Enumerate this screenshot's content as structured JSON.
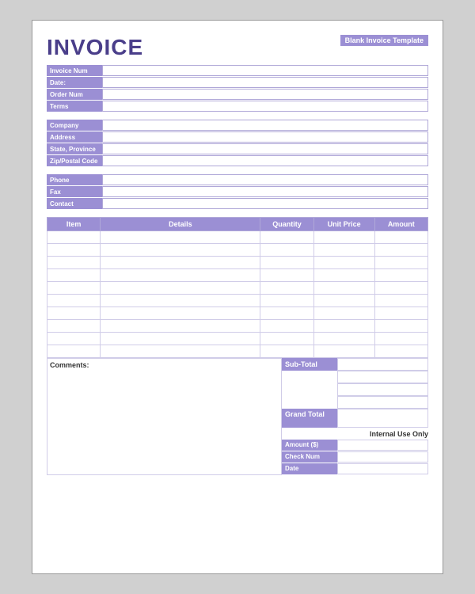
{
  "header": {
    "title": "INVOICE",
    "template_label": "Blank Invoice Template"
  },
  "invoice_info": [
    {
      "label": "Invoice Num",
      "value": ""
    },
    {
      "label": "Date:",
      "value": ""
    },
    {
      "label": "Order Num",
      "value": ""
    },
    {
      "label": "Terms",
      "value": ""
    }
  ],
  "company_info": [
    {
      "label": "Company",
      "value": ""
    },
    {
      "label": "Address",
      "value": ""
    },
    {
      "label": "State, Province",
      "value": ""
    },
    {
      "label": "Zip/Postal Code",
      "value": ""
    }
  ],
  "contact_info": [
    {
      "label": "Phone",
      "value": ""
    },
    {
      "label": "Fax",
      "value": ""
    },
    {
      "label": "Contact",
      "value": ""
    }
  ],
  "table": {
    "columns": [
      "Item",
      "Details",
      "Quantity",
      "Unit Price",
      "Amount"
    ],
    "rows": 10
  },
  "comments_label": "Comments:",
  "totals": {
    "sub_total_label": "Sub-Total",
    "grand_total_label": "Grand Total",
    "blank_rows": 3,
    "internal_use": "Internal Use Only",
    "payment_fields": [
      {
        "label": "Amount ($)",
        "value": ""
      },
      {
        "label": "Check Num",
        "value": ""
      },
      {
        "label": "Date",
        "value": ""
      }
    ]
  }
}
